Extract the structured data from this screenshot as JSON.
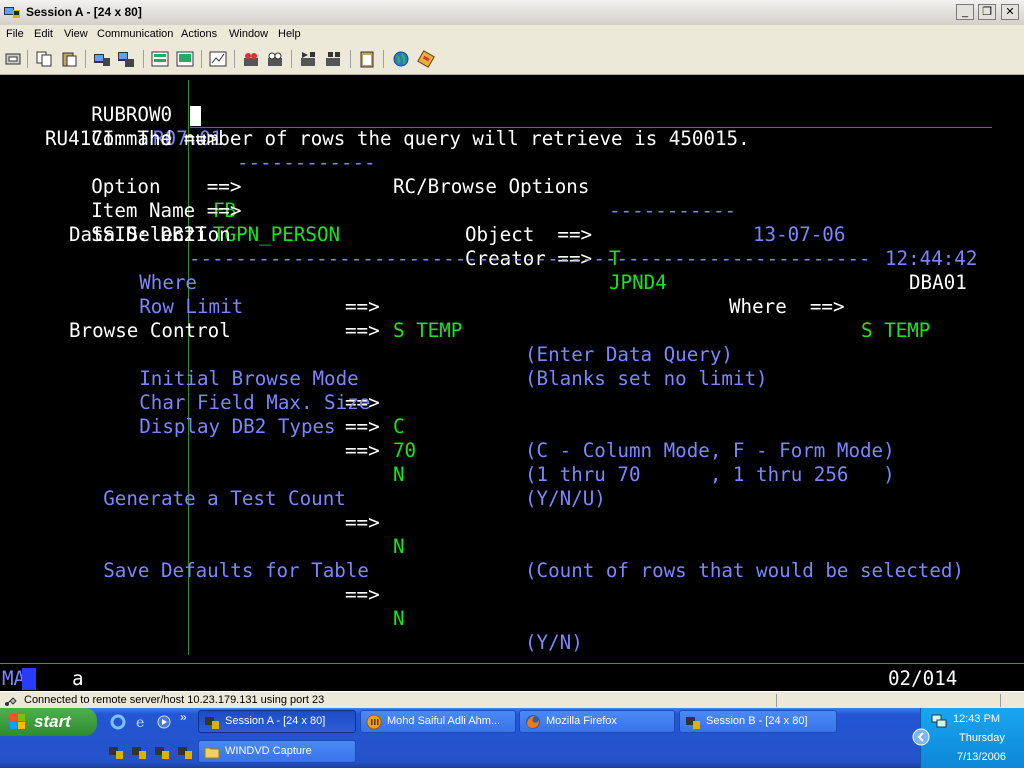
{
  "window": {
    "title": "Session A - [24 x 80]",
    "minimize": "_",
    "restore": "❐",
    "close": "✕"
  },
  "menu": [
    "File",
    "Edit",
    "View",
    "Communication",
    "Actions",
    "Window",
    "Help"
  ],
  "toolbar_icons": [
    "print-icon",
    "copy-icon",
    "paste-icon",
    "send-icon",
    "receive-icon",
    "display-icon",
    "display2-icon",
    "chart-icon",
    "record-icon",
    "playback-icon",
    "macro-icon",
    "macro-stop-icon",
    "clipboard-icon",
    "globe-icon",
    "keypad-icon"
  ],
  "screen": {
    "header": {
      "panel_id": "RUBROW0",
      "release": "R07.01",
      "dashes_left": "------------",
      "title": "RC/Browse Options",
      "dashes_right": "-----------",
      "date": "13-07-06",
      "time": "12:44:42"
    },
    "command_label": "Command ==>",
    "message": "RU417I: The number of rows the query will retrieve is 450015.",
    "option": {
      "label": "Option    ==>",
      "value": "FB"
    },
    "object": {
      "label": "Object  ==>",
      "value": "T"
    },
    "item_name": {
      "label": "Item Name ==>",
      "value": "TGPN_PERSON"
    },
    "creator": {
      "label": "Creator ==>",
      "value": "JPND4"
    },
    "where_top": {
      "label": "Where  ==>",
      "value": "S TEMP"
    },
    "ssid": {
      "label": "SSID: DB2T",
      "dashes": "-----------------------------------------------------------",
      "user": "DBA01"
    },
    "data_selection": {
      "heading": "Data Selection",
      "where": {
        "label": "Where",
        "arrow": "==>",
        "value": "S TEMP",
        "hint": "(Enter Data Query)"
      },
      "row_limit": {
        "label": "Row Limit",
        "arrow": "==>",
        "value": "",
        "hint": "(Blanks set no limit)"
      }
    },
    "browse_control": {
      "heading": "Browse Control",
      "initial_mode": {
        "label": "Initial Browse Mode",
        "arrow": "==>",
        "value": "C",
        "hint": "(C - Column Mode, F - Form Mode)"
      },
      "char_max": {
        "label": "Char Field Max. Size",
        "arrow": "==>",
        "value": "70",
        "hint": "(1 thru 70      , 1 thru 256   )"
      },
      "db2_types": {
        "label": "Display DB2 Types",
        "arrow": "==>",
        "value": "N",
        "hint": "(Y/N/U)"
      }
    },
    "test_count": {
      "label": "Generate a Test Count",
      "arrow": "==>",
      "value": "N",
      "hint": "(Count of rows that would be selected)"
    },
    "save_defaults": {
      "label": "Save Defaults for Table",
      "arrow": "==>",
      "value": "N",
      "hint": "(Y/N)"
    }
  },
  "oia": {
    "mode": "MA",
    "indicator": "a",
    "cursor_pos": "02/014"
  },
  "status": {
    "text": "Connected to remote server/host 10.23.179.131 using port 23"
  },
  "taskbar": {
    "start": "start",
    "tasks": [
      {
        "label": "Session A - [24 x 80]",
        "active": true
      },
      {
        "label": "Mohd Saiful Adli Ahm...",
        "active": false
      },
      {
        "label": "Mozilla Firefox",
        "active": false
      },
      {
        "label": "Session B - [24 x 80]",
        "active": false
      },
      {
        "label": "WINDVD Capture",
        "active": false
      }
    ],
    "clock": {
      "time": "12:43 PM",
      "day": "Thursday",
      "date": "7/13/2006"
    }
  },
  "colors": {
    "screen_bg": "#000000",
    "protected_text": "#7b86ff",
    "input_text": "#19e419",
    "emphasis_text": "#ffffff",
    "taskbar_blue": "#2452c8",
    "start_green": "#2e8b2e"
  }
}
